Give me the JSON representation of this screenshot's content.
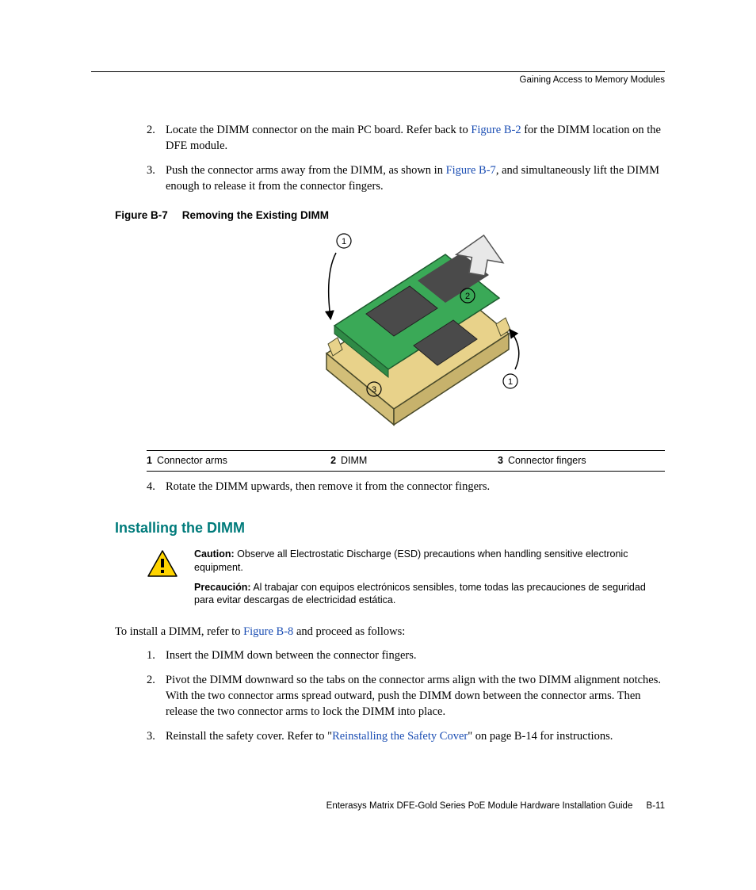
{
  "running_head": "Gaining Access to Memory Modules",
  "steps_a": [
    {
      "n": "2.",
      "pre": "Locate the DIMM connector on the main PC board. Refer back to ",
      "link": "Figure B-2",
      "post": " for the DIMM location on the DFE module."
    },
    {
      "n": "3.",
      "pre": "Push the connector arms away from the DIMM, as shown in ",
      "link": "Figure B-7",
      "post": ", and simultaneously lift the DIMM enough to release it from the connector fingers."
    }
  ],
  "figure": {
    "label": "Figure B-7",
    "title": "Removing the Existing DIMM",
    "callouts": [
      {
        "n": "1",
        "t": "Connector arms"
      },
      {
        "n": "2",
        "t": "DIMM"
      },
      {
        "n": "3",
        "t": "Connector fingers"
      }
    ]
  },
  "steps_b": [
    {
      "n": "4.",
      "pre": "Rotate the DIMM upwards, then remove it from the connector fingers.",
      "link": "",
      "post": ""
    }
  ],
  "section_heading": "Installing the DIMM",
  "caution": {
    "label": "Caution:",
    "text": " Observe all Electrostatic Discharge (ESD) precautions when handling sensitive electronic equipment.",
    "label_es": "Precaución:",
    "text_es": " Al trabajar con equipos electrónicos sensibles, tome todas las precauciones de seguridad para evitar descargas  de electricidad estática."
  },
  "intro": {
    "pre": "To install a DIMM, refer to ",
    "link": "Figure B-8",
    "post": " and proceed as follows:"
  },
  "steps_c": [
    {
      "n": "1.",
      "pre": "Insert the DIMM down between the connector fingers.",
      "link": "",
      "post": ""
    },
    {
      "n": "2.",
      "pre": "Pivot the DIMM downward so the tabs on the connector arms align with the two DIMM alignment notches. With the two connector arms spread outward, push the DIMM down between the connector arms. Then release the two connector arms to lock the DIMM into place.",
      "link": "",
      "post": ""
    },
    {
      "n": "3.",
      "pre": "Reinstall the safety cover. Refer to \"",
      "link": "Reinstalling the Safety Cover",
      "post": "\" on page B-14 for instructions."
    }
  ],
  "footer": {
    "doc": "Enterasys Matrix DFE-Gold Series PoE Module Hardware Installation Guide",
    "page": "B-11"
  }
}
